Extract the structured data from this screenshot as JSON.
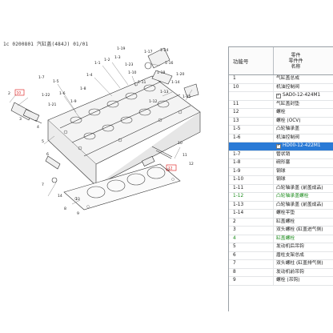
{
  "diagram": {
    "header_text": "1c 0200801 汽缸盖(484J) 01/01",
    "callouts": [
      "1-1",
      "1-2",
      "1-3",
      "1-4",
      "1-5",
      "1-6",
      "1-7",
      "1-8",
      "1-9",
      "1-10",
      "1-11",
      "1-12",
      "1-13",
      "1-14",
      "1-15",
      "1-16",
      "1-17",
      "1-18",
      "1-19",
      "1-20",
      "1-21",
      "1-22",
      "1-23",
      "1-24",
      "2",
      "3",
      "4",
      "5",
      "6",
      "7",
      "8",
      "9",
      "10",
      "11",
      "12",
      "13",
      "14"
    ],
    "red_labels": [
      "10",
      "12"
    ]
  },
  "table": {
    "col_func": "功能号",
    "col_name_lines": [
      "零件",
      "零件件",
      "名称"
    ],
    "rows": [
      {
        "num": "1",
        "name": "气缸盖总成",
        "style": "normal"
      },
      {
        "num": "10",
        "name": "机油控制阀",
        "style": "normal"
      },
      {
        "num": "",
        "name": "SAD0-12-424M1",
        "style": "subheader",
        "checked": true
      },
      {
        "num": "11",
        "name": "气缸盖封垫",
        "style": "normal"
      },
      {
        "num": "12",
        "name": "螺栓",
        "style": "normal"
      },
      {
        "num": "13",
        "name": "螺栓 (OCV)",
        "style": "normal"
      },
      {
        "num": "1-5",
        "name": "凸轮轴承盖",
        "style": "normal"
      },
      {
        "num": "1-6",
        "name": "机油控制阀",
        "style": "normal"
      },
      {
        "num": "",
        "name": "HD00-12-422M1",
        "style": "selected",
        "checked": true
      },
      {
        "num": "1-7",
        "name": "管状销",
        "style": "normal"
      },
      {
        "num": "1-8",
        "name": "碗形塞",
        "style": "normal"
      },
      {
        "num": "1-9",
        "name": "钢球",
        "style": "normal"
      },
      {
        "num": "1-10",
        "name": "钢球",
        "style": "normal"
      },
      {
        "num": "1-11",
        "name": "凸轮轴承盖 (前盖成品)",
        "style": "normal"
      },
      {
        "num": "1-12",
        "name": "凸轮轴承盖螺栓",
        "style": "green"
      },
      {
        "num": "1-13",
        "name": "凸轮轴承盖 (前盖成品)",
        "style": "normal"
      },
      {
        "num": "1-14",
        "name": "螺栓平垫",
        "style": "normal"
      },
      {
        "num": "2",
        "name": "缸盖螺栓",
        "style": "normal"
      },
      {
        "num": "3",
        "name": "双头螺栓 (缸盖进气侧)",
        "style": "normal"
      },
      {
        "num": "4",
        "name": "缸盖螺栓",
        "style": "green"
      },
      {
        "num": "5",
        "name": "发动机后吊钩",
        "style": "normal"
      },
      {
        "num": "6",
        "name": "盾柱支架总成",
        "style": "normal"
      },
      {
        "num": "7",
        "name": "双头螺柱 (缸盖排气侧)",
        "style": "normal"
      },
      {
        "num": "8",
        "name": "发动机前吊钩",
        "style": "normal"
      },
      {
        "num": "9",
        "name": "螺栓 (吊钩)",
        "style": "normal"
      }
    ]
  }
}
